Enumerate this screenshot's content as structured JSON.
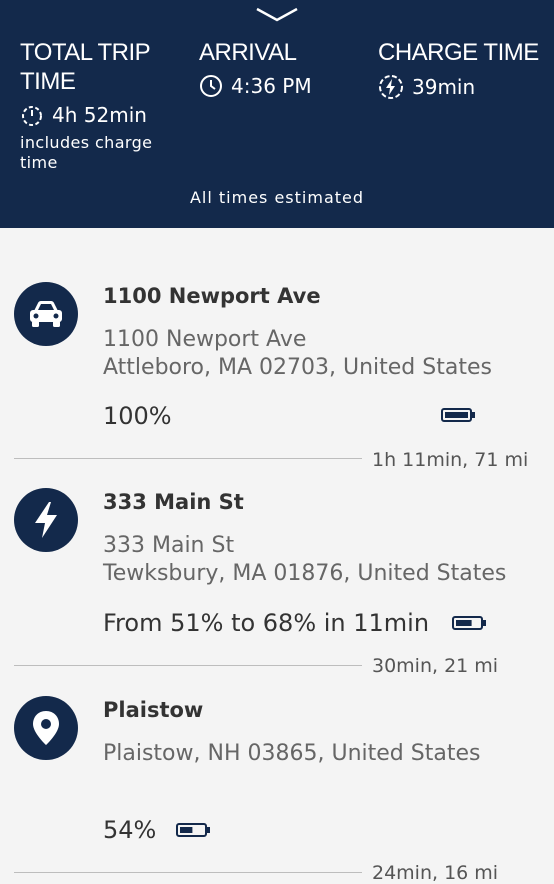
{
  "header": {
    "total": {
      "title": "TOTAL TRIP\nTIME",
      "value": "4h 52min",
      "note": "includes charge time"
    },
    "arrival": {
      "title": "ARRIVAL",
      "value": "4:36 PM"
    },
    "charge": {
      "title": "CHARGE TIME",
      "value": "39min"
    },
    "estimate_note": "All times estimated"
  },
  "stops": [
    {
      "name": "1100 Newport Ave",
      "address": "1100 Newport Ave\nAttleboro, MA 02703, United States",
      "battery_text": "100%",
      "battery_level": 1.0,
      "icon": "car-icon"
    },
    {
      "name": "333 Main St",
      "address": "333 Main St\nTewksbury, MA 01876, United States",
      "battery_text": "From 51% to 68% in 11min",
      "battery_level": 0.68,
      "icon": "charging-bolt-icon"
    },
    {
      "name": "Plaistow",
      "address": "Plaistow, NH 03865, United States",
      "battery_text": "54%",
      "battery_level": 0.54,
      "icon": "location-pin-icon"
    }
  ],
  "legs": [
    "1h 11min, 71 mi",
    "30min, 21 mi",
    "24min, 16 mi"
  ],
  "colors": {
    "navy": "#13294b",
    "background": "#f4f4f4"
  }
}
